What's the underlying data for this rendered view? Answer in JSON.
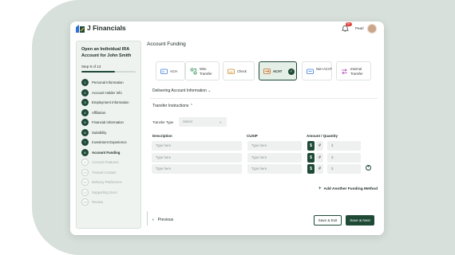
{
  "header": {
    "brand": "J Financials",
    "notification_count": "5+",
    "user_name": "Pearl"
  },
  "sidebar": {
    "title": "Open an Individual IRA Account for John Smith",
    "step_text": "Step 8 of 13",
    "progress_fraction": 0.615,
    "steps": [
      {
        "num": "1",
        "label": "Personal Information",
        "state": "done"
      },
      {
        "num": "2",
        "label": "Account Holder Info",
        "state": "done"
      },
      {
        "num": "3",
        "label": "Employment Information",
        "state": "done"
      },
      {
        "num": "4",
        "label": "Affiliation",
        "state": "done"
      },
      {
        "num": "5",
        "label": "Financial Information",
        "state": "done"
      },
      {
        "num": "6",
        "label": "Suitability",
        "state": "done"
      },
      {
        "num": "7",
        "label": "Investment Experience",
        "state": "done"
      },
      {
        "num": "8",
        "label": "Account Funding",
        "state": "active"
      },
      {
        "num": "9",
        "label": "Account Features",
        "state": "future"
      },
      {
        "num": "10",
        "label": "Trusted Contact",
        "state": "future"
      },
      {
        "num": "11",
        "label": "Delivery Preference",
        "state": "future"
      },
      {
        "num": "12",
        "label": "Supporting Docs",
        "state": "future"
      },
      {
        "num": "13",
        "label": "Review",
        "state": "future"
      }
    ]
  },
  "main": {
    "title": "Account Funding",
    "methods": [
      {
        "label": "ACH",
        "icon": "ach-icon",
        "selected": false
      },
      {
        "label": "Wire Transfer",
        "icon": "wire-transfer-icon",
        "selected": false
      },
      {
        "label": "Check",
        "icon": "check-icon",
        "selected": false
      },
      {
        "label": "ACAT",
        "icon": "acat-icon",
        "selected": true
      },
      {
        "label": "Non-ACAT",
        "icon": "non-acat-icon",
        "selected": false
      },
      {
        "label": "Internal Transfer",
        "icon": "internal-transfer-icon",
        "selected": false
      }
    ],
    "delivering_section": "Delivering Account Information",
    "transfer_section": "Transfer Instructions",
    "transfer_type_label": "Transfer Type",
    "transfer_type_placeholder": "Select",
    "columns": {
      "description": "Description",
      "cusip": "CUSIP",
      "amount": "Amount / Quantity"
    },
    "rows": [
      {
        "description_placeholder": "Type here",
        "cusip_placeholder": "Type here",
        "currency": "$",
        "hash": "#",
        "amount_placeholder": "$"
      },
      {
        "description_placeholder": "Type here",
        "cusip_placeholder": "Type here",
        "currency": "$",
        "hash": "#",
        "amount_placeholder": "$"
      },
      {
        "description_placeholder": "Type here",
        "cusip_placeholder": "Type here",
        "currency": "$",
        "hash": "#",
        "amount_placeholder": "$"
      }
    ],
    "add_method_label": "Add Another Funding Method"
  },
  "footer": {
    "previous": "Previous",
    "save_exit": "Save & Exit",
    "save_next": "Save & Next"
  },
  "colors": {
    "primary": "#1e4a36",
    "background": "#d7e0da",
    "badge": "#e0413b"
  }
}
